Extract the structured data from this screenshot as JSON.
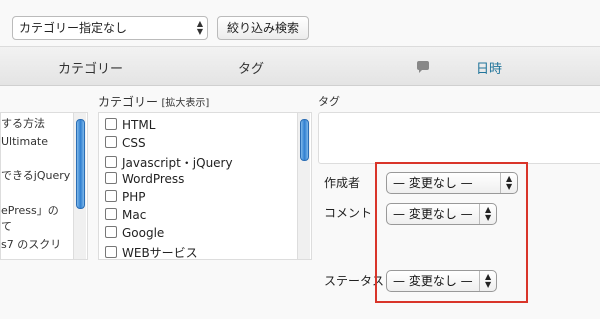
{
  "filters": {
    "category_select_value": "カテゴリー指定なし",
    "filter_button_label": "絞り込み検索"
  },
  "table_header": {
    "category": "カテゴリー",
    "tag": "タグ",
    "date": "日時"
  },
  "left_list": {
    "items": [
      "する方法",
      "Ultimate",
      "",
      "できるjQuery",
      "",
      "ePress」の",
      "て",
      "s7 のスクリ"
    ]
  },
  "category_panel": {
    "label": "カテゴリー",
    "expand_link": "[拡大表示]",
    "items": [
      "HTML",
      "CSS",
      "Javascript・jQuery",
      "WordPress",
      "PHP",
      "Mac",
      "Google",
      "WEBサービス"
    ]
  },
  "tag_panel": {
    "label": "タグ"
  },
  "bulk_fields": {
    "author_label": "作成者",
    "author_value": "— 変更なし —",
    "comment_label": "コメント",
    "comment_value": "— 変更なし —",
    "status_label": "ステータス",
    "status_value": "— 変更なし —"
  },
  "colors": {
    "highlight": "#d9352a",
    "link_blue": "#21759b",
    "scroll_thumb": "#2f7fd0"
  }
}
